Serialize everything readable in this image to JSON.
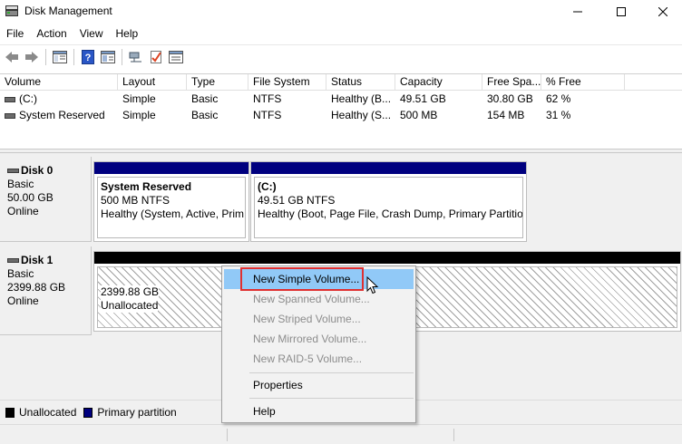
{
  "window": {
    "title": "Disk Management"
  },
  "menu": [
    "File",
    "Action",
    "View",
    "Help"
  ],
  "toolbar": {
    "icons": [
      "back-arrow-icon",
      "forward-arrow-icon",
      "console-tree-icon",
      "help-icon",
      "properties-icon",
      "connect-icon",
      "check-icon",
      "settings-icon"
    ]
  },
  "volume_list": {
    "columns": [
      "Volume",
      "Layout",
      "Type",
      "File System",
      "Status",
      "Capacity",
      "Free Spa...",
      "% Free"
    ],
    "rows": [
      [
        "(C:)",
        "Simple",
        "Basic",
        "NTFS",
        "Healthy (B...",
        "49.51 GB",
        "30.80 GB",
        "62 %"
      ],
      [
        "System Reserved",
        "Simple",
        "Basic",
        "NTFS",
        "Healthy (S...",
        "500 MB",
        "154 MB",
        "31 %"
      ]
    ]
  },
  "disks": [
    {
      "name": "Disk 0",
      "type": "Basic",
      "size": "50.00 GB",
      "state": "Online",
      "partitions": [
        {
          "name": "System Reserved",
          "detail": "500 MB NTFS",
          "status": "Healthy (System, Active, Prim"
        },
        {
          "name": "(C:)",
          "detail": "49.51 GB NTFS",
          "status": "Healthy (Boot, Page File, Crash Dump, Primary Partitio"
        }
      ]
    },
    {
      "name": "Disk 1",
      "type": "Basic",
      "size": "2399.88 GB",
      "state": "Online",
      "partitions": [
        {
          "name": "",
          "detail": "2399.88 GB",
          "status": "Unallocated"
        }
      ]
    }
  ],
  "legend": {
    "unallocated": "Unallocated",
    "primary": "Primary partition"
  },
  "context_menu": {
    "new_simple": "New Simple Volume...",
    "new_spanned": "New Spanned Volume...",
    "new_striped": "New Striped Volume...",
    "new_mirrored": "New Mirrored Volume...",
    "new_raid5": "New RAID-5 Volume...",
    "properties": "Properties",
    "help": "Help"
  },
  "colors": {
    "primary_partition": "#00007f",
    "unallocated": "#000000",
    "menu_highlight": "#91c9f7",
    "annotation_box": "#e03030"
  }
}
